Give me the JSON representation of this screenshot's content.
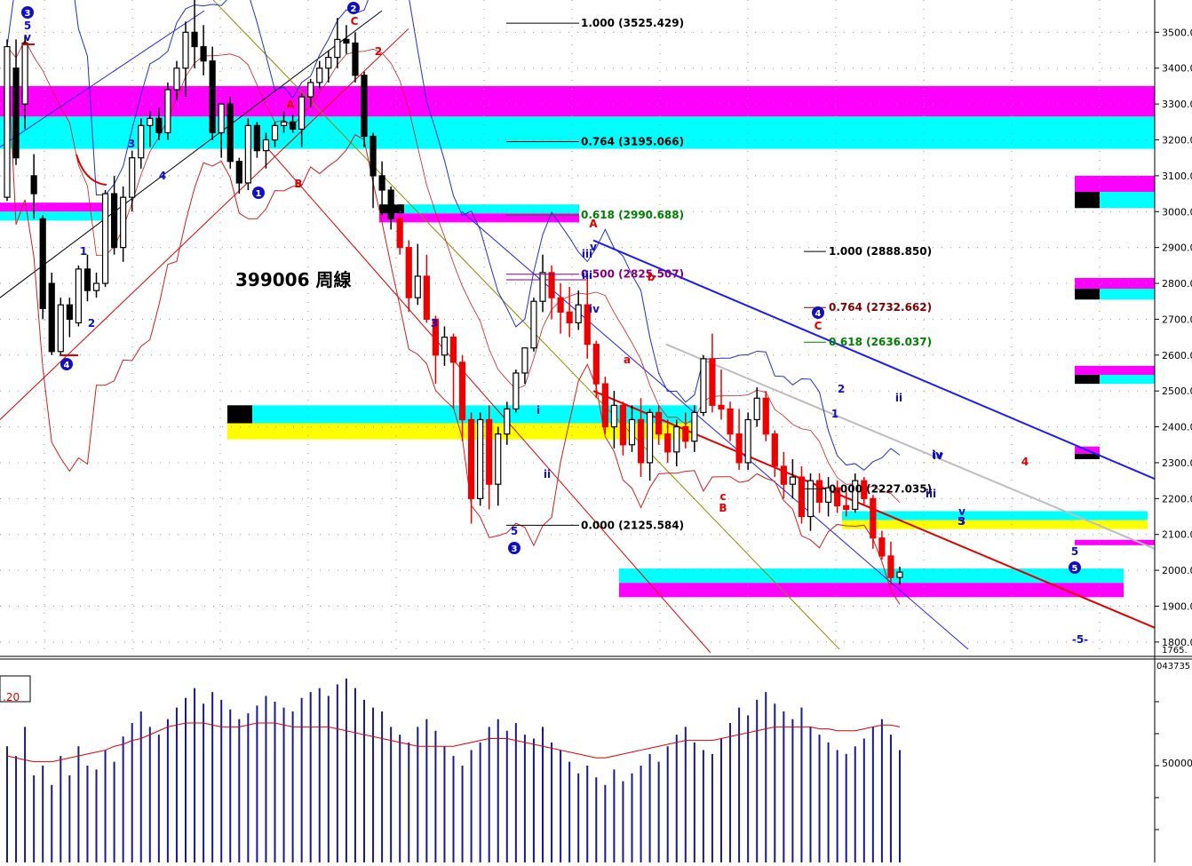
{
  "title": "399006 周線",
  "price_axis": {
    "ticks": [
      "3500.0",
      "3400.0",
      "3300.0",
      "3200.0",
      "3100.0",
      "3000.0",
      "2900.0",
      "2800.0",
      "2700.0",
      "2600.0",
      "2500.0",
      "2400.0",
      "2300.0",
      "2200.0",
      "2100.0",
      "2000.0",
      "1900.0",
      "1800.0"
    ],
    "tick_values": [
      3500,
      3400,
      3300,
      3200,
      3100,
      3000,
      2900,
      2800,
      2700,
      2600,
      2500,
      2400,
      2300,
      2200,
      2100,
      2000,
      1900,
      1800
    ],
    "bottom_label": "1765.",
    "range": [
      1765,
      3590
    ]
  },
  "volume_axis": {
    "top_label": "043735",
    "mid_label": "50000"
  },
  "volume_box_label": ".20",
  "fib_levels": [
    {
      "label": "1.000 (3525.429)",
      "value": 3525.429,
      "color": "#000000"
    },
    {
      "label": "0.764 (3195.066)",
      "value": 3195.066,
      "color": "#000000"
    },
    {
      "label": "0.618 (2990.688)",
      "value": 2990.688,
      "color": "#008000"
    },
    {
      "label": "0.500 (2825.507)",
      "value": 2825.507,
      "color": "#800080"
    },
    {
      "label": "0.000 (2125.584)",
      "value": 2125.584,
      "color": "#000000"
    },
    {
      "label": "1.000 (2888.850)",
      "value": 2888.85,
      "color": "#000000"
    },
    {
      "label": "0.764 (2732.662)",
      "value": 2732.662,
      "color": "#800000"
    },
    {
      "label": "0.618 (2636.037)",
      "value": 2636.037,
      "color": "#008000"
    },
    {
      "label": "0.000 (2227.035)",
      "value": 2227.035,
      "color": "#000000"
    }
  ],
  "wave_labels": {
    "circle": [
      "3",
      "2",
      "1",
      "4",
      "3",
      "4",
      "5"
    ],
    "blue": [
      "5",
      "v",
      "iii",
      "iv",
      "3",
      "4",
      "1",
      "2",
      "3",
      "5",
      "i",
      "ii",
      "iii",
      "v",
      "iv",
      "5",
      "2",
      "1",
      "ii",
      "iv",
      "iii",
      "v",
      "3",
      "5",
      "-5-"
    ],
    "red": [
      "C",
      "A",
      "B",
      "A",
      "b",
      "a",
      "c",
      "B",
      "C",
      "2",
      "4"
    ]
  },
  "chart_data": {
    "type": "candlestick",
    "title": "399006 周線",
    "xlabel": "",
    "ylabel": "",
    "ylim": [
      1765,
      3590
    ],
    "grid": true,
    "candles": [
      {
        "o": 3040,
        "h": 3480,
        "l": 3030,
        "c": 3460
      },
      {
        "o": 3400,
        "h": 3480,
        "l": 3130,
        "c": 3150
      },
      {
        "o": 3300,
        "h": 3490,
        "l": 3230,
        "c": 3470
      },
      {
        "o": 3100,
        "h": 3160,
        "l": 2980,
        "c": 3050
      },
      {
        "o": 2980,
        "h": 2990,
        "l": 2700,
        "c": 2730
      },
      {
        "o": 2800,
        "h": 2830,
        "l": 2600,
        "c": 2610
      },
      {
        "o": 2610,
        "h": 2760,
        "l": 2600,
        "c": 2740
      },
      {
        "o": 2740,
        "h": 2760,
        "l": 2650,
        "c": 2700
      },
      {
        "o": 2690,
        "h": 2850,
        "l": 2680,
        "c": 2840
      },
      {
        "o": 2840,
        "h": 2880,
        "l": 2750,
        "c": 2780
      },
      {
        "o": 2780,
        "h": 2830,
        "l": 2760,
        "c": 2800
      },
      {
        "o": 2800,
        "h": 3060,
        "l": 2790,
        "c": 3050
      },
      {
        "o": 3050,
        "h": 3100,
        "l": 2880,
        "c": 2900
      },
      {
        "o": 2900,
        "h": 3070,
        "l": 2860,
        "c": 3040
      },
      {
        "o": 3040,
        "h": 3170,
        "l": 3000,
        "c": 3150
      },
      {
        "o": 3150,
        "h": 3260,
        "l": 3120,
        "c": 3240
      },
      {
        "o": 3240,
        "h": 3280,
        "l": 3180,
        "c": 3260
      },
      {
        "o": 3260,
        "h": 3290,
        "l": 3200,
        "c": 3220
      },
      {
        "o": 3220,
        "h": 3360,
        "l": 3200,
        "c": 3340
      },
      {
        "o": 3340,
        "h": 3420,
        "l": 3310,
        "c": 3400
      },
      {
        "o": 3400,
        "h": 3530,
        "l": 3320,
        "c": 3500
      },
      {
        "o": 3500,
        "h": 3590,
        "l": 3400,
        "c": 3460
      },
      {
        "o": 3460,
        "h": 3520,
        "l": 3380,
        "c": 3420
      },
      {
        "o": 3420,
        "h": 3460,
        "l": 3200,
        "c": 3220
      },
      {
        "o": 3220,
        "h": 3300,
        "l": 3150,
        "c": 3300
      },
      {
        "o": 3300,
        "h": 3320,
        "l": 3120,
        "c": 3140
      },
      {
        "o": 3140,
        "h": 3150,
        "l": 3050,
        "c": 3080
      },
      {
        "o": 3080,
        "h": 3260,
        "l": 3060,
        "c": 3240
      },
      {
        "o": 3240,
        "h": 3250,
        "l": 3150,
        "c": 3170
      },
      {
        "o": 3170,
        "h": 3220,
        "l": 3120,
        "c": 3200
      },
      {
        "o": 3200,
        "h": 3250,
        "l": 3180,
        "c": 3240
      },
      {
        "o": 3240,
        "h": 3280,
        "l": 3220,
        "c": 3250
      },
      {
        "o": 3250,
        "h": 3270,
        "l": 3220,
        "c": 3230
      },
      {
        "o": 3230,
        "h": 3330,
        "l": 3180,
        "c": 3320
      },
      {
        "o": 3320,
        "h": 3370,
        "l": 3290,
        "c": 3360
      },
      {
        "o": 3360,
        "h": 3420,
        "l": 3340,
        "c": 3400
      },
      {
        "o": 3400,
        "h": 3450,
        "l": 3360,
        "c": 3430
      },
      {
        "o": 3430,
        "h": 3540,
        "l": 3400,
        "c": 3480
      },
      {
        "o": 3480,
        "h": 3520,
        "l": 3440,
        "c": 3470
      },
      {
        "o": 3470,
        "h": 3500,
        "l": 3360,
        "c": 3380
      },
      {
        "o": 3380,
        "h": 3390,
        "l": 3180,
        "c": 3210
      },
      {
        "o": 3210,
        "h": 3220,
        "l": 3010,
        "c": 3100
      },
      {
        "o": 3100,
        "h": 3140,
        "l": 2990,
        "c": 3060
      },
      {
        "o": 3060,
        "h": 3070,
        "l": 2950,
        "c": 2980
      },
      {
        "o": 2980,
        "h": 2990,
        "l": 2880,
        "c": 2900
      },
      {
        "o": 2900,
        "h": 2920,
        "l": 2720,
        "c": 2760
      },
      {
        "o": 2760,
        "h": 2910,
        "l": 2740,
        "c": 2820
      },
      {
        "o": 2820,
        "h": 2880,
        "l": 2690,
        "c": 2700
      },
      {
        "o": 2700,
        "h": 2710,
        "l": 2520,
        "c": 2600
      },
      {
        "o": 2600,
        "h": 2680,
        "l": 2570,
        "c": 2650
      },
      {
        "o": 2650,
        "h": 2660,
        "l": 2450,
        "c": 2580
      },
      {
        "o": 2580,
        "h": 2600,
        "l": 2360,
        "c": 2420
      },
      {
        "o": 2420,
        "h": 2440,
        "l": 2130,
        "c": 2200
      },
      {
        "o": 2200,
        "h": 2440,
        "l": 2180,
        "c": 2420
      },
      {
        "o": 2420,
        "h": 2460,
        "l": 2170,
        "c": 2240
      },
      {
        "o": 2240,
        "h": 2400,
        "l": 2180,
        "c": 2380
      },
      {
        "o": 2380,
        "h": 2470,
        "l": 2350,
        "c": 2450
      },
      {
        "o": 2450,
        "h": 2560,
        "l": 2440,
        "c": 2550
      },
      {
        "o": 2550,
        "h": 2620,
        "l": 2520,
        "c": 2620
      },
      {
        "o": 2620,
        "h": 2760,
        "l": 2610,
        "c": 2750
      },
      {
        "o": 2750,
        "h": 2880,
        "l": 2720,
        "c": 2830
      },
      {
        "o": 2830,
        "h": 2850,
        "l": 2700,
        "c": 2760
      },
      {
        "o": 2760,
        "h": 2800,
        "l": 2660,
        "c": 2720
      },
      {
        "o": 2720,
        "h": 2790,
        "l": 2650,
        "c": 2690
      },
      {
        "o": 2690,
        "h": 2780,
        "l": 2670,
        "c": 2740
      },
      {
        "o": 2740,
        "h": 2820,
        "l": 2590,
        "c": 2630
      },
      {
        "o": 2630,
        "h": 2640,
        "l": 2480,
        "c": 2520
      },
      {
        "o": 2520,
        "h": 2540,
        "l": 2380,
        "c": 2400
      },
      {
        "o": 2400,
        "h": 2500,
        "l": 2340,
        "c": 2460
      },
      {
        "o": 2460,
        "h": 2470,
        "l": 2320,
        "c": 2350
      },
      {
        "o": 2350,
        "h": 2460,
        "l": 2330,
        "c": 2420
      },
      {
        "o": 2420,
        "h": 2480,
        "l": 2260,
        "c": 2300
      },
      {
        "o": 2300,
        "h": 2450,
        "l": 2250,
        "c": 2440
      },
      {
        "o": 2440,
        "h": 2460,
        "l": 2350,
        "c": 2380
      },
      {
        "o": 2380,
        "h": 2420,
        "l": 2300,
        "c": 2330
      },
      {
        "o": 2330,
        "h": 2420,
        "l": 2290,
        "c": 2400
      },
      {
        "o": 2400,
        "h": 2440,
        "l": 2340,
        "c": 2360
      },
      {
        "o": 2360,
        "h": 2460,
        "l": 2330,
        "c": 2440
      },
      {
        "o": 2440,
        "h": 2600,
        "l": 2430,
        "c": 2590
      },
      {
        "o": 2590,
        "h": 2660,
        "l": 2440,
        "c": 2460
      },
      {
        "o": 2460,
        "h": 2560,
        "l": 2420,
        "c": 2450
      },
      {
        "o": 2450,
        "h": 2470,
        "l": 2360,
        "c": 2380
      },
      {
        "o": 2380,
        "h": 2450,
        "l": 2280,
        "c": 2300
      },
      {
        "o": 2300,
        "h": 2440,
        "l": 2280,
        "c": 2420
      },
      {
        "o": 2420,
        "h": 2510,
        "l": 2400,
        "c": 2480
      },
      {
        "o": 2480,
        "h": 2500,
        "l": 2360,
        "c": 2380
      },
      {
        "o": 2380,
        "h": 2390,
        "l": 2260,
        "c": 2290
      },
      {
        "o": 2290,
        "h": 2330,
        "l": 2200,
        "c": 2240
      },
      {
        "o": 2240,
        "h": 2310,
        "l": 2200,
        "c": 2260
      },
      {
        "o": 2260,
        "h": 2290,
        "l": 2130,
        "c": 2150
      },
      {
        "o": 2150,
        "h": 2270,
        "l": 2110,
        "c": 2250
      },
      {
        "o": 2250,
        "h": 2270,
        "l": 2160,
        "c": 2190
      },
      {
        "o": 2190,
        "h": 2260,
        "l": 2150,
        "c": 2230
      },
      {
        "o": 2230,
        "h": 2250,
        "l": 2160,
        "c": 2180
      },
      {
        "o": 2180,
        "h": 2230,
        "l": 2150,
        "c": 2170
      },
      {
        "o": 2170,
        "h": 2270,
        "l": 2160,
        "c": 2250
      },
      {
        "o": 2250,
        "h": 2260,
        "l": 2180,
        "c": 2200
      },
      {
        "o": 2200,
        "h": 2210,
        "l": 2060,
        "c": 2090
      },
      {
        "o": 2090,
        "h": 2110,
        "l": 2030,
        "c": 2040
      },
      {
        "o": 2040,
        "h": 2080,
        "l": 1960,
        "c": 1980
      },
      {
        "o": 1980,
        "h": 2010,
        "l": 1960,
        "c": 1995
      }
    ],
    "volume": [
      60,
      55,
      70,
      45,
      50,
      40,
      55,
      45,
      60,
      50,
      48,
      58,
      52,
      65,
      72,
      78,
      70,
      66,
      74,
      80,
      85,
      90,
      82,
      88,
      84,
      79,
      74,
      77,
      81,
      86,
      83,
      80,
      78,
      85,
      88,
      90,
      86,
      92,
      95,
      90,
      84,
      80,
      78,
      70,
      66,
      62,
      70,
      74,
      68,
      60,
      55,
      50,
      58,
      62,
      70,
      74,
      68,
      72,
      66,
      64,
      70,
      62,
      58,
      52,
      46,
      50,
      44,
      40,
      48,
      42,
      46,
      50,
      56,
      52,
      60,
      66,
      70,
      62,
      58,
      56,
      64,
      72,
      80,
      76,
      84,
      88,
      82,
      78,
      74,
      80,
      70,
      66,
      62,
      58,
      56,
      60,
      64,
      70,
      74,
      66,
      58
    ],
    "volume_ma": [
      55,
      54,
      53,
      52,
      52,
      52,
      53,
      54,
      55,
      56,
      57,
      58,
      60,
      61,
      63,
      64,
      66,
      68,
      70,
      71,
      72,
      72,
      72,
      71,
      70,
      70,
      70,
      71,
      72,
      72,
      72,
      71,
      70,
      70,
      70,
      70,
      70,
      69,
      68,
      67,
      66,
      65,
      64,
      63,
      62,
      61,
      60,
      60,
      60,
      60,
      60,
      61,
      62,
      63,
      64,
      64,
      64,
      63,
      62,
      61,
      60,
      59,
      58,
      57,
      56,
      55,
      54,
      54,
      55,
      56,
      57,
      58,
      59,
      60,
      61,
      62,
      63,
      63,
      63,
      63,
      64,
      65,
      66,
      67,
      68,
      69,
      70,
      70,
      70,
      70,
      70,
      69,
      69,
      68,
      68,
      68,
      69,
      70,
      71,
      71,
      70
    ]
  }
}
